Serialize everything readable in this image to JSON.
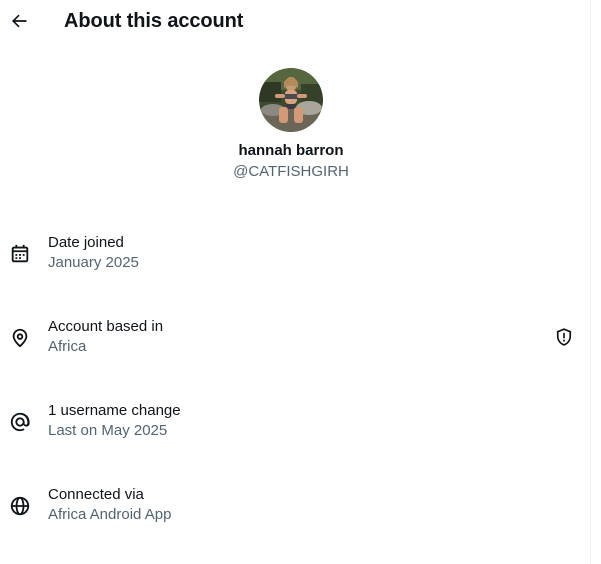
{
  "header": {
    "title": "About this account",
    "back_icon": "arrow-left-icon"
  },
  "profile": {
    "display_name": "hannah barron",
    "handle": "@CATFISHGIRH"
  },
  "rows": [
    {
      "label": "Date joined",
      "value": "January 2025",
      "icon": "calendar-icon"
    },
    {
      "label": "Account based in",
      "value": "Africa",
      "icon": "location-pin-icon",
      "trailing_icon": "shield-alert-icon"
    },
    {
      "label": "1 username change",
      "value": "Last on May 2025",
      "icon": "at-sign-icon"
    },
    {
      "label": "Connected via",
      "value": "Africa Android App",
      "icon": "globe-icon"
    }
  ],
  "colors": {
    "primary_text": "#0f1419",
    "secondary_text": "#536471",
    "divider": "#eff3f4"
  }
}
